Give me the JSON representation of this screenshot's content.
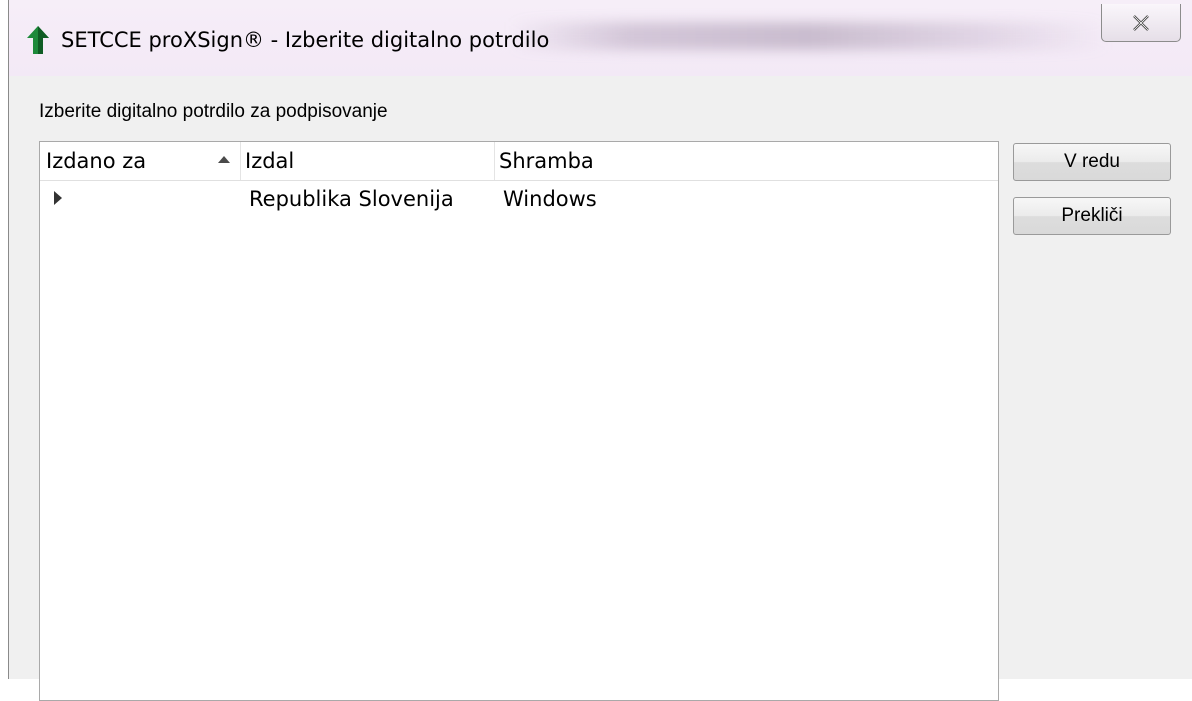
{
  "window": {
    "title": "SETCCE proXSign® - Izberite digitalno potrdilo",
    "close_icon": "close-icon",
    "app_icon": "setcce-logo-icon"
  },
  "dialog": {
    "prompt": "Izberite digitalno potrdilo za podpisovanje",
    "columns": [
      "Izdano za",
      "Izdal",
      "Shramba"
    ],
    "sort_icon": "sort-ascending-icon",
    "rows": [
      {
        "expander_icon": "expand-arrow-icon",
        "issued_to": "",
        "issuer": "Republika Slovenija",
        "store": "Windows"
      }
    ],
    "buttons": {
      "ok": "V redu",
      "cancel": "Prekliči"
    }
  }
}
